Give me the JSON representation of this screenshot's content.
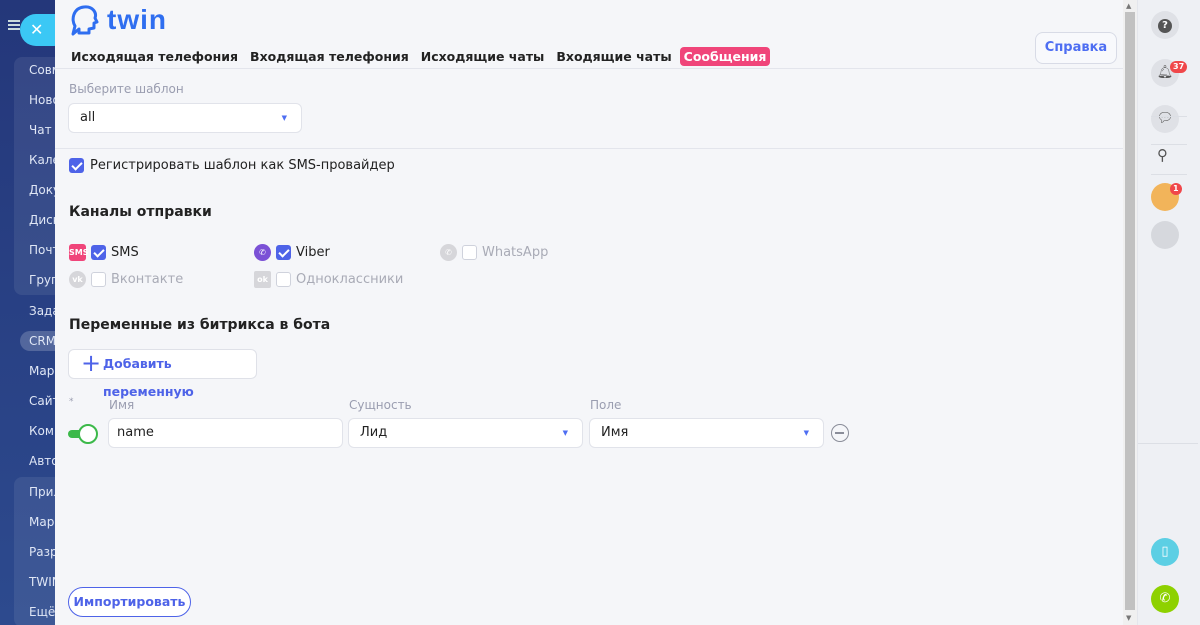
{
  "left_sidebar": {
    "items": [
      "Совм",
      "Ново",
      "Чат и",
      "Кале",
      "Доку",
      "Диск",
      "Почт",
      "Груп",
      "Зада",
      "CRM",
      "Мар",
      "Сайт",
      "Ком",
      "Авто",
      "Прил",
      "Мар",
      "Разр",
      "TWIN",
      "Ещё"
    ]
  },
  "app": {
    "logo": "twin",
    "help_label": "Справка"
  },
  "tabs": [
    {
      "label": "Исходящая телефония"
    },
    {
      "label": "Входящая телефония"
    },
    {
      "label": "Исходящие чаты"
    },
    {
      "label": "Входящие чаты"
    },
    {
      "label": "Сообщения",
      "active": true
    }
  ],
  "template": {
    "label": "Выберите шаблон",
    "value": "all"
  },
  "register_sms": {
    "label": "Регистрировать шаблон как SMS-провайдер",
    "checked": true
  },
  "channels": {
    "title": "Каналы отправки",
    "items": [
      {
        "label": "SMS",
        "checked": true,
        "icon": "sms-icon",
        "color": "#f0457a"
      },
      {
        "label": "Viber",
        "checked": true,
        "icon": "viber-icon",
        "color": "#7b51d6"
      },
      {
        "label": "WhatsApp",
        "checked": false,
        "icon": "whatsapp-icon",
        "color": "#cfcfd4"
      },
      {
        "label": "Вконтакте",
        "checked": false,
        "icon": "vk-icon",
        "color": "#cfcfd4"
      },
      {
        "label": "Одноклассники",
        "checked": false,
        "icon": "ok-icon",
        "color": "#cfcfd4"
      }
    ]
  },
  "variables": {
    "title": "Переменные из битрикса в бота",
    "add_label": "Добавить переменную",
    "required_mark": "*",
    "headers": {
      "name": "Имя",
      "entity": "Сущность",
      "field": "Поле"
    },
    "rows": [
      {
        "enabled": true,
        "name": "name",
        "entity": "Лид",
        "field": "Имя"
      }
    ]
  },
  "import_label": "Импортировать",
  "right_bar": {
    "notifications_count": "37",
    "avatar_badge": "1",
    "help_glyph": "?"
  },
  "colors": {
    "accent": "#4e63e8",
    "tab_active": "#f0457a",
    "toggle": "#3cb94a"
  }
}
